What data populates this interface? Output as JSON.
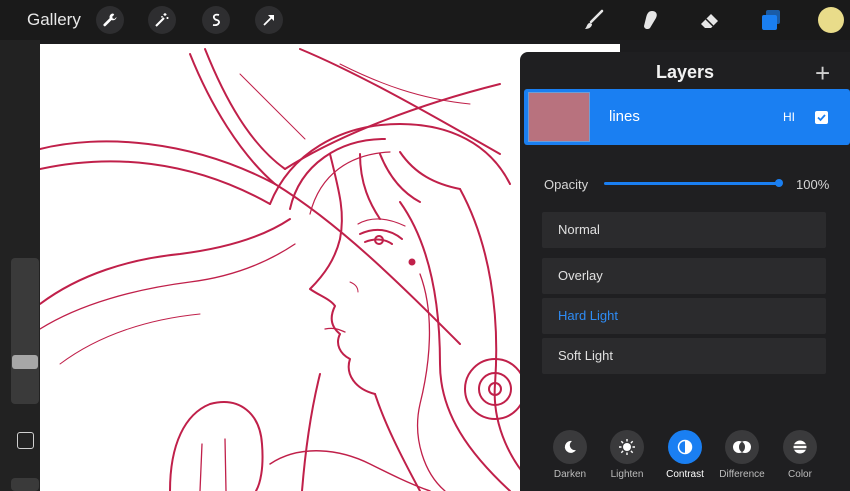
{
  "toolbar": {
    "gallery_label": "Gallery",
    "left_tools": [
      "wrench-icon",
      "magic-wand-icon",
      "selection-icon",
      "transform-arrow-icon"
    ],
    "right_tools": [
      "brush-icon",
      "smudge-icon",
      "eraser-icon",
      "layers-icon"
    ],
    "active_tool": "layers-icon",
    "current_color": "#e9dc8a",
    "accent_color": "#1a7ff2"
  },
  "sidebar": {
    "brush_size": 0.35,
    "opacity_slider": 0.6
  },
  "canvas": {
    "line_color": "#c0204a"
  },
  "layers_panel": {
    "title": "Layers",
    "add_icon": "plus-icon",
    "layer": {
      "name": "lines",
      "blend_mode_abbr": "HI",
      "visible": true
    },
    "opacity_label": "Opacity",
    "opacity_value": "100%",
    "modes": [
      {
        "label": "Normal",
        "active": false
      },
      {
        "label": "Overlay",
        "active": false
      },
      {
        "label": "Hard Light",
        "active": true
      },
      {
        "label": "Soft Light",
        "active": false
      }
    ],
    "categories": [
      {
        "label": "Darken",
        "icon": "moon-icon",
        "active": false
      },
      {
        "label": "Lighten",
        "icon": "sun-icon",
        "active": false
      },
      {
        "label": "Contrast",
        "icon": "contrast-icon",
        "active": true
      },
      {
        "label": "Difference",
        "icon": "difference-icon",
        "active": false
      },
      {
        "label": "Color",
        "icon": "color-stripes-icon",
        "active": false
      }
    ]
  }
}
